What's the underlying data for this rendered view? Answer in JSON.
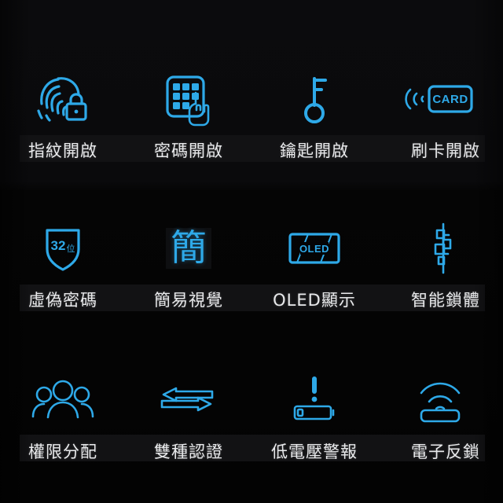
{
  "page": {
    "background_color": "#000000",
    "accent_color": "#2ea9e8",
    "label_color": "#e9eaec",
    "band_color": "#121214",
    "grid": {
      "columns": 4,
      "rows": 3
    }
  },
  "features": [
    {
      "label": "指紋開啟",
      "icon": "fingerprint-lock-icon"
    },
    {
      "label": "密碼開啟",
      "icon": "keypad-touch-icon"
    },
    {
      "label": "鑰匙開啟",
      "icon": "key-icon"
    },
    {
      "label": "刷卡開啟",
      "icon": "rfid-card-icon",
      "icon_text": "CARD"
    },
    {
      "label": "虛偽密碼",
      "icon": "shield-icon",
      "icon_text": "32位",
      "icon_text_number": "32",
      "icon_text_unit": "位"
    },
    {
      "label": "簡易視覺",
      "icon": "simplified-character-icon",
      "icon_text": "簡"
    },
    {
      "label": "OLED顯示",
      "icon": "oled-screen-icon",
      "icon_text": "OLED"
    },
    {
      "label": "智能鎖體",
      "icon": "smart-lock-body-icon"
    },
    {
      "label": "權限分配",
      "icon": "users-group-icon"
    },
    {
      "label": "雙種認證",
      "icon": "two-way-arrows-icon"
    },
    {
      "label": "低電壓警報",
      "icon": "low-battery-alert-icon"
    },
    {
      "label": "電子反鎖",
      "icon": "wireless-deadbolt-icon"
    }
  ]
}
